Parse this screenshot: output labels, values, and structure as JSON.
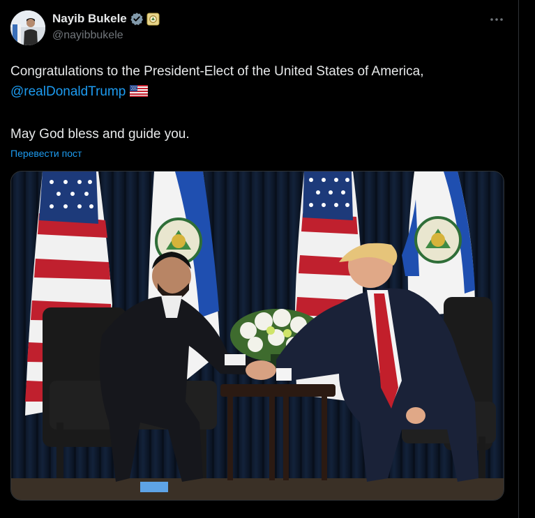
{
  "author": {
    "display_name": "Nayib Bukele",
    "handle": "@nayibbukele",
    "verified_icon": "verified-badge-icon",
    "affiliate_icon": "el-salvador-affiliate-badge-icon"
  },
  "menu": {
    "more_icon": "more-horizontal-icon"
  },
  "post": {
    "line1": "Congratulations to the President-Elect of the United States of America,",
    "mention": "@realDonaldTrump",
    "flag_emoji": "us-flag-icon",
    "line2": "May God bless and guide you.",
    "translate_label": "Перевести пост"
  },
  "media": {
    "kind": "photo",
    "subject": "two-men-shaking-hands-between-us-and-el-salvador-flags"
  },
  "colors": {
    "background": "#000000",
    "text": "#e7e9ea",
    "secondary_text": "#71767b",
    "link": "#1d9bf0",
    "divider": "#2f3336"
  }
}
